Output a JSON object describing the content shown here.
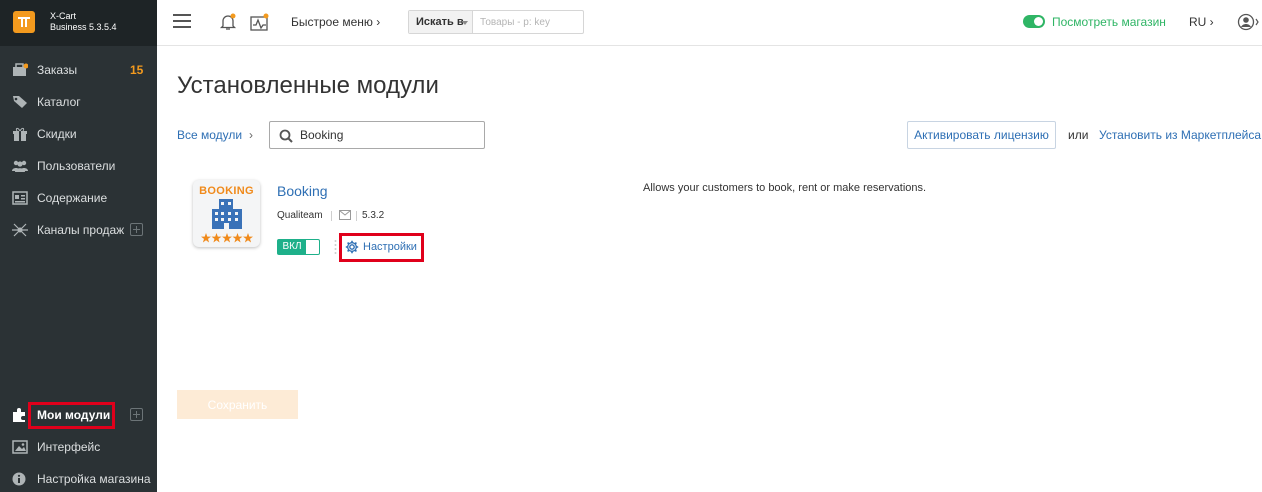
{
  "brand": {
    "name": "X-Cart",
    "version": "Business 5.3.5.4",
    "accent": "#f39a1e"
  },
  "sidebar": {
    "items": [
      {
        "label": "Заказы",
        "badge": "15",
        "icon": "orders-icon"
      },
      {
        "label": "Каталог",
        "icon": "tag-icon"
      },
      {
        "label": "Скидки",
        "icon": "gift-icon"
      },
      {
        "label": "Пользователи",
        "icon": "users-icon"
      },
      {
        "label": "Содержание",
        "icon": "content-icon"
      },
      {
        "label": "Каналы продаж",
        "icon": "sales-channels-icon"
      },
      {
        "label": "Мои модули",
        "icon": "puzzle-icon",
        "active": true
      },
      {
        "label": "Интерфейс",
        "icon": "image-icon"
      },
      {
        "label": "Настройка магазина",
        "icon": "info-icon"
      }
    ]
  },
  "header": {
    "quick_menu": "Быстрое меню ›",
    "search_scope": "Искать в",
    "search_placeholder": "Товары - p: key",
    "view_store": "Посмотреть магазин",
    "lang": "RU ›"
  },
  "main": {
    "title": "Установленные модули",
    "breadcrumb": "Все модули",
    "breadcrumb_chevron": "›",
    "search_value": "Booking",
    "activate_button": "Активировать лицензию",
    "or": "или",
    "install_link": "Установить из Маркетплейса",
    "save_button": "Сохранить"
  },
  "module": {
    "icon_text": "BOOKING",
    "name": "Booking",
    "author": "Qualiteam",
    "version": "5.3.2",
    "toggle_label": "ВКЛ",
    "settings_label": "Настройки",
    "description": "Allows your customers to book, rent or make reservations."
  },
  "colors": {
    "sidebar": "#2b3235",
    "link": "#2e6fb4",
    "success": "#2fb565",
    "highlight": "#e0001b"
  }
}
